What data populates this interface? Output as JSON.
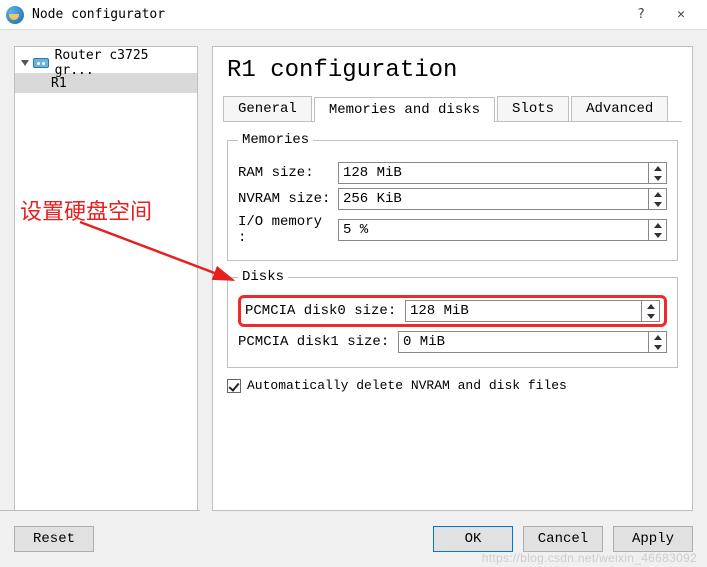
{
  "titlebar": {
    "title": "Node configurator",
    "help": "?",
    "close": "✕"
  },
  "tree": {
    "root_label": "Router c3725 gr...",
    "child_label": "R1"
  },
  "panel": {
    "heading": "R1 configuration",
    "tabs": {
      "general": "General",
      "mem": "Memories and disks",
      "slots": "Slots",
      "adv": "Advanced"
    },
    "memories": {
      "legend": "Memories",
      "ram_label": "RAM size:",
      "ram_value": "128 MiB",
      "nvram_label": "NVRAM size:",
      "nvram_value": "256 KiB",
      "io_label": "I/O memory :",
      "io_value": "5 %"
    },
    "disks": {
      "legend": "Disks",
      "d0_label": "PCMCIA disk0 size:",
      "d0_value": "128 MiB",
      "d1_label": "PCMCIA disk1 size:",
      "d1_value": "0 MiB"
    },
    "autodel": "Automatically delete NVRAM and disk files"
  },
  "footer": {
    "reset": "Reset",
    "ok": "OK",
    "cancel": "Cancel",
    "apply": "Apply"
  },
  "annotation": {
    "text": "设置硬盘空间"
  },
  "watermark": "https://blog.csdn.net/weixin_46683092"
}
